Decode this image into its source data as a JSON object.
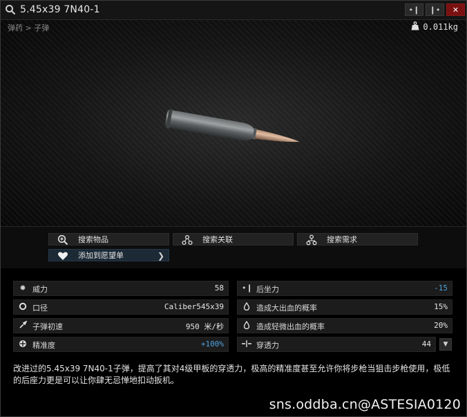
{
  "window": {
    "title": "5.45x39 7N40-1",
    "title_icon": "search-icon",
    "buttons": [
      {
        "name": "collapse-left",
        "symbol": "•❙"
      },
      {
        "name": "collapse-right",
        "symbol": "❙•"
      },
      {
        "name": "close",
        "symbol": "✕"
      }
    ]
  },
  "preview": {
    "breadcrumb": "弹药 > 子弹",
    "weight": "0.011kg",
    "weight_icon": "weight-icon"
  },
  "actions": {
    "search_item": "搜索物品",
    "search_related": "搜索关联",
    "search_needs": "搜索需求",
    "add_wishlist": "添加到愿望单"
  },
  "stats": {
    "left": [
      {
        "icon": "damage-icon",
        "label": "威力",
        "value": "58"
      },
      {
        "icon": "caliber-icon",
        "label": "口径",
        "value": "Caliber545x39"
      },
      {
        "icon": "velocity-icon",
        "label": "子弹初速",
        "value": "950 米/秒"
      },
      {
        "icon": "accuracy-icon",
        "label": "精准度",
        "value": "+100%"
      }
    ],
    "right": [
      {
        "icon": "recoil-icon",
        "label": "后坐力",
        "value": "-15"
      },
      {
        "icon": "heavy-bleed-icon",
        "label": "造成大出血的概率",
        "value": "15%"
      },
      {
        "icon": "light-bleed-icon",
        "label": "造成轻微出血的概率",
        "value": "20%"
      },
      {
        "icon": "penetration-icon",
        "label": "穿透力",
        "value": "44"
      }
    ]
  },
  "description": "改进过的5.45x39 7N40-1子弹，提高了其对4级甲板的穿透力，极高的精准度甚至允许你将步枪当狙击步枪使用，极低的后座力更是可以让你肆无忌惮地扣动扳机。",
  "watermark": "sns.oddba.cn@ASTESIA0120",
  "colors": {
    "accent_blue": "#4da3e0",
    "close_red": "#7a1010",
    "wishlist_bg": "#1c2a36"
  }
}
